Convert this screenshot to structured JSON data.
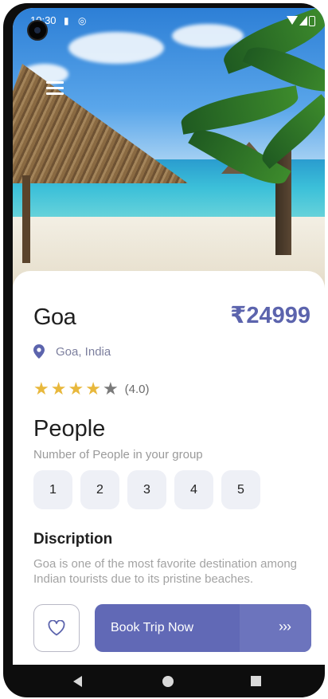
{
  "status_bar": {
    "time": "10:30"
  },
  "trip": {
    "title": "Goa",
    "price": "₹24999",
    "location": "Goa, India",
    "rating": {
      "stars_filled": 4,
      "stars_total": 5,
      "label": "(4.0)"
    }
  },
  "people": {
    "title": "People",
    "subtitle": "Number of People in your group",
    "options": [
      "1",
      "2",
      "3",
      "4",
      "5"
    ]
  },
  "description": {
    "title": "Discription",
    "text": "Goa is one of the most favorite destination among Indian tourists due to its pristine beaches."
  },
  "actions": {
    "book_label": "Book Trip Now",
    "book_arrows": "›››"
  },
  "colors": {
    "accent": "#5c64ad",
    "button": "#6169b6",
    "star_on": "#e8b83c",
    "star_off": "#7a7a7a",
    "chip_bg": "#eef0f6"
  },
  "icons": {
    "menu": "menu-icon",
    "location": "location-pin-icon",
    "favorite": "heart-icon",
    "nav_back": "back-triangle-icon",
    "nav_home": "home-circle-icon",
    "nav_recent": "recent-square-icon"
  }
}
